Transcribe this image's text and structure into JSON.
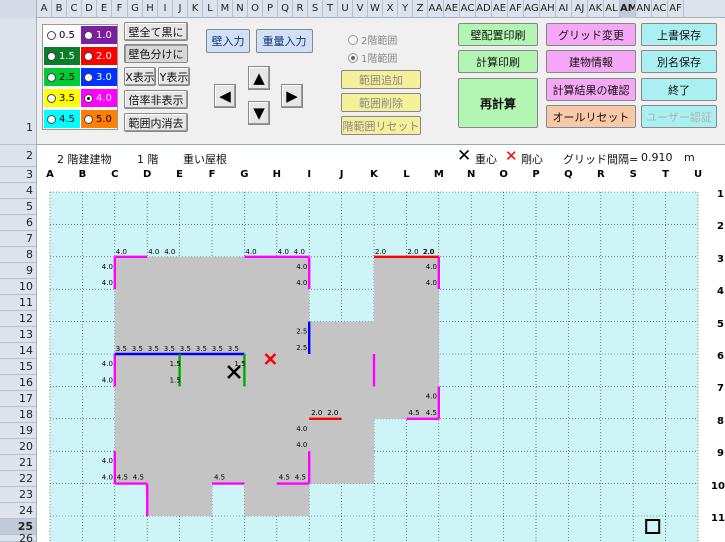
{
  "columns": [
    "A",
    "B",
    "C",
    "D",
    "E",
    "F",
    "G",
    "H",
    "I",
    "J",
    "K",
    "L",
    "M",
    "N",
    "O",
    "P",
    "Q",
    "R",
    "S",
    "T",
    "U",
    "V",
    "W",
    "X",
    "Y",
    "Z",
    "AA",
    "AE",
    "AC",
    "AD",
    "AE",
    "AF",
    "AG",
    "AH",
    "AI",
    "AJ",
    "AK",
    "AL",
    "AM",
    "AN",
    "AC",
    "AF"
  ],
  "active_column": "AM",
  "rows": [
    "1",
    "2",
    "3",
    "4",
    "5",
    "6",
    "7",
    "8",
    "9",
    "10",
    "11",
    "12",
    "13",
    "14",
    "15",
    "16",
    "17",
    "18",
    "19",
    "20",
    "21",
    "22",
    "23",
    "24",
    "25",
    "26"
  ],
  "active_row": "25",
  "panel": {
    "colors": [
      {
        "label": "0.5",
        "bg": "#ffffff",
        "fg": "#000000",
        "selected": false
      },
      {
        "label": "1.0",
        "bg": "#7a1fa2",
        "fg": "#ffffff",
        "selected": false
      },
      {
        "label": "1.5",
        "bg": "#0a7d2a",
        "fg": "#ffffff",
        "selected": false
      },
      {
        "label": "2.0",
        "bg": "#ff0000",
        "fg": "#ffffff",
        "selected": false
      },
      {
        "label": "2.5",
        "bg": "#00cc33",
        "fg": "#000000",
        "selected": false
      },
      {
        "label": "3.0",
        "bg": "#0033ff",
        "fg": "#ffffff",
        "selected": false
      },
      {
        "label": "3.5",
        "bg": "#ffff00",
        "fg": "#000000",
        "selected": false
      },
      {
        "label": "4.0",
        "bg": "#ff00ff",
        "fg": "#ffffff",
        "selected": true
      },
      {
        "label": "4.5",
        "bg": "#00ffff",
        "fg": "#000000",
        "selected": false
      },
      {
        "label": "5.0",
        "bg": "#ff7f00",
        "fg": "#000000",
        "selected": false
      }
    ],
    "wall_all_black": "壁全て黒に",
    "wall_color_split": "壁色分けに",
    "x_display": "X表示",
    "y_display": "Y表示",
    "zoom_hide": "倍率非表示",
    "range_erase": "範囲内消去",
    "wall_input": "壁入力",
    "weight_input": "重量入力",
    "floor2_range": "2階範囲",
    "floor1_range": "1階範囲",
    "range_add": "範囲追加",
    "range_delete": "範囲削除",
    "range_reset": "階範囲リセット",
    "wall_layout_print": "壁配置印刷",
    "calc_print": "計算印刷",
    "recalc": "再計算",
    "grid_change": "グリッド変更",
    "building_info": "建物情報",
    "check_results": "計算結果の確認",
    "all_reset": "オールリセット",
    "overwrite_save": "上書保存",
    "save_as": "別名保存",
    "exit": "終了",
    "user_auth": "ユーザー認証",
    "arrow_up": "▲",
    "arrow_down": "▼",
    "arrow_left": "◀",
    "arrow_right": "▶"
  },
  "info": {
    "building": "2 階建建物",
    "floor": "1 階",
    "roof": "重い屋根",
    "centroid_mark": "✕",
    "centroid_label": "重心",
    "rigidity_mark": "✕",
    "rigidity_label": "剛心",
    "grid_label": "グリッド間隔=",
    "grid_value": "0.910",
    "grid_unit": "m"
  },
  "grid_letters": [
    "A",
    "B",
    "C",
    "D",
    "E",
    "F",
    "G",
    "H",
    "I",
    "J",
    "K",
    "L",
    "M",
    "N",
    "O",
    "P",
    "Q",
    "R",
    "S",
    "T",
    "U"
  ],
  "right_numbers": [
    "1",
    "2",
    "3",
    "4",
    "5",
    "6",
    "7",
    "8",
    "9",
    "10",
    "11"
  ],
  "plan_labels": {
    "v40": "4.0",
    "v45": "4.5",
    "v20": "2.0",
    "v25": "2.5",
    "v35": "3.5",
    "v15": "1.5"
  },
  "colors": {
    "plan_bg": "#cdf5f7",
    "building": "#c4c4c4",
    "wall_magenta": "#ff00ff",
    "wall_blue": "#0000ff",
    "wall_red": "#ff0000",
    "wall_green": "#00aa00"
  }
}
